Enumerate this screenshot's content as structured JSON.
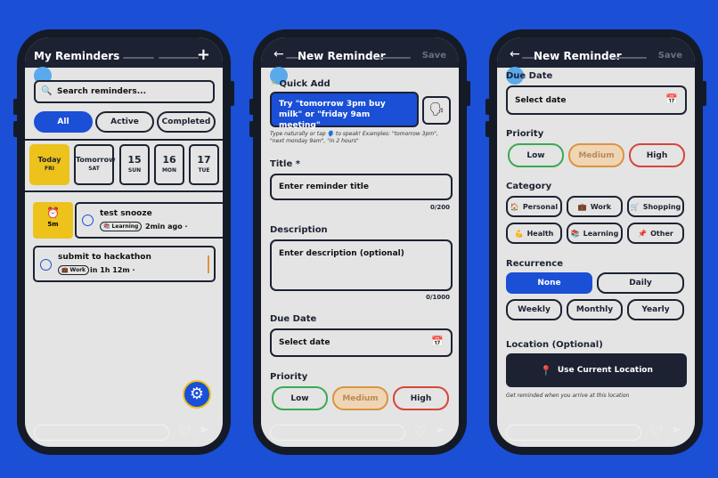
{
  "colors": {
    "background": "#1a4fd6",
    "phone": "#151a27",
    "accent": "#1a4fd6",
    "today": "#ecc21b",
    "low": "#3aaa55",
    "medium": "#d99442",
    "high": "#d8453a"
  },
  "screen1": {
    "title": "My Reminders",
    "add_icon": "+",
    "search_placeholder": "Search reminders...",
    "filters": [
      "All",
      "Active",
      "Completed"
    ],
    "days": [
      {
        "top": "Today",
        "bottom": "FRI"
      },
      {
        "top": "Tomorrow",
        "bottom": "SAT"
      },
      {
        "top": "15",
        "bottom": "SUN"
      },
      {
        "top": "16",
        "bottom": "MON"
      },
      {
        "top": "17",
        "bottom": "TUE"
      }
    ],
    "snooze": {
      "badge": "5m",
      "title": "test snooze",
      "tag": "📚 Learning",
      "time": "2min ago ·"
    },
    "item2": {
      "title": "submit to hackathon",
      "tag": "💼 Work",
      "time": "in 1h 12m ·"
    }
  },
  "screen2": {
    "title": "New Reminder",
    "save": "Save",
    "quick_add": "Quick Add",
    "quick_text": "Try \"tomorrow 3pm buy milk\" or \"friday 9am meeting\"",
    "hint": "Type naturally or tap 🗣️ to speak! Examples: \"tomorrow 3pm\", \"next monday 9am\", \"in 2 hours\"",
    "title_label": "Title *",
    "title_placeholder": "Enter reminder title",
    "title_count": "0/200",
    "desc_label": "Description",
    "desc_placeholder": "Enter description (optional)",
    "desc_count": "0/1000",
    "due_label": "Due Date",
    "due_placeholder": "Select date",
    "priority_label": "Priority",
    "priorities": [
      "Low",
      "Medium",
      "High"
    ]
  },
  "screen3": {
    "title": "New Reminder",
    "save": "Save",
    "due_label": "Due Date",
    "due_placeholder": "Select date",
    "priority_label": "Priority",
    "priorities": [
      "Low",
      "Medium",
      "High"
    ],
    "category_label": "Category",
    "categories": [
      {
        "icon": "🏠",
        "label": "Personal"
      },
      {
        "icon": "💼",
        "label": "Work"
      },
      {
        "icon": "🛒",
        "label": "Shopping"
      },
      {
        "icon": "💪",
        "label": "Health"
      },
      {
        "icon": "📚",
        "label": "Learning"
      },
      {
        "icon": "📌",
        "label": "Other"
      }
    ],
    "recurrence_label": "Recurrence",
    "recurrence": [
      "None",
      "Daily",
      "Weekly",
      "Monthly",
      "Yearly"
    ],
    "location_label": "Location (Optional)",
    "location_button": "Use Current Location",
    "location_hint": "Get reminded when you arrive at this location"
  }
}
